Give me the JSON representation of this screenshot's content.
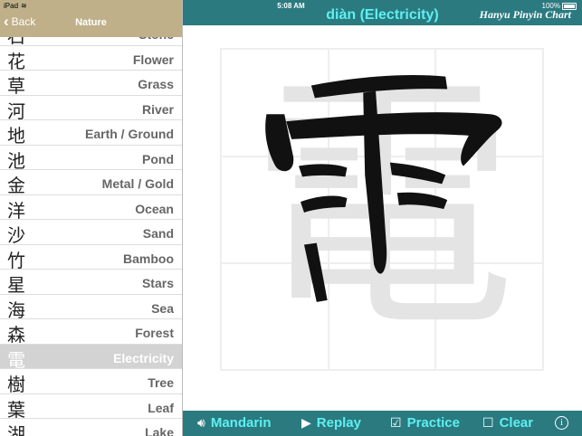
{
  "status_bar": {
    "device": "iPad",
    "time": "5:08 AM",
    "battery": "100%"
  },
  "sidebar": {
    "back_label": "Back",
    "title": "Nature",
    "items": [
      {
        "zh": "石",
        "en": "Stone"
      },
      {
        "zh": "花",
        "en": "Flower"
      },
      {
        "zh": "草",
        "en": "Grass"
      },
      {
        "zh": "河",
        "en": "River"
      },
      {
        "zh": "地",
        "en": "Earth / Ground"
      },
      {
        "zh": "池",
        "en": "Pond"
      },
      {
        "zh": "金",
        "en": "Metal / Gold"
      },
      {
        "zh": "洋",
        "en": "Ocean"
      },
      {
        "zh": "沙",
        "en": "Sand"
      },
      {
        "zh": "竹",
        "en": "Bamboo"
      },
      {
        "zh": "星",
        "en": "Stars"
      },
      {
        "zh": "海",
        "en": "Sea"
      },
      {
        "zh": "森",
        "en": "Forest"
      },
      {
        "zh": "電",
        "en": "Electricity",
        "selected": true
      },
      {
        "zh": "樹",
        "en": "Tree"
      },
      {
        "zh": "葉",
        "en": "Leaf"
      },
      {
        "zh": "湖",
        "en": "Lake"
      }
    ]
  },
  "header": {
    "title": "diàn (Electricity)",
    "app_name": "Hanyu Pinyin Chart"
  },
  "character": {
    "glyph": "電"
  },
  "toolbar": {
    "mandarin_label": "Mandarin",
    "replay_label": "Replay",
    "practice_label": "Practice",
    "clear_label": "Clear",
    "practice_checked": true,
    "clear_checked": false
  },
  "colors": {
    "header_bg": "#2a7a80",
    "accent": "#5ef0f0",
    "sidebar_header": "#bfb08a",
    "selected_row": "#d3d3d3"
  }
}
